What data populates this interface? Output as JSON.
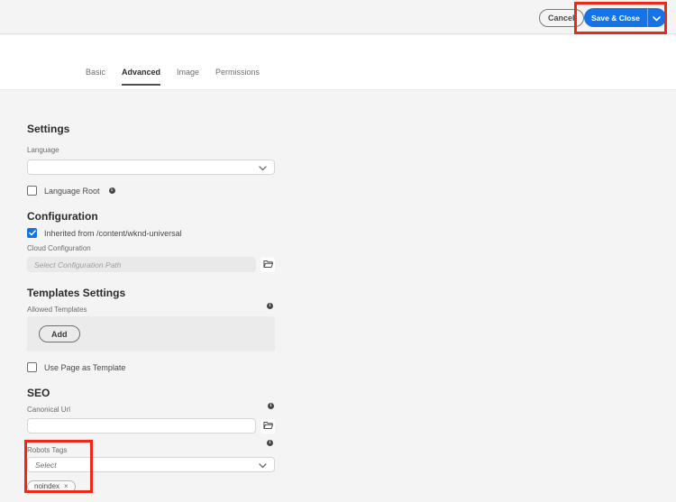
{
  "colors": {
    "accent_blue": "#1473e6",
    "annotation_red": "#ec2817",
    "page_background": "#f4f4f5"
  },
  "header": {
    "cancel_label": "Cancel",
    "save_close_label": "Save & Close"
  },
  "tabs": [
    {
      "label": "Basic",
      "active": false
    },
    {
      "label": "Advanced",
      "active": true
    },
    {
      "label": "Image",
      "active": false
    },
    {
      "label": "Permissions",
      "active": false
    }
  ],
  "settings": {
    "title": "Settings",
    "language": {
      "label": "Language",
      "value": ""
    },
    "language_root": {
      "label": "Language Root",
      "checked": false
    }
  },
  "configuration": {
    "title": "Configuration",
    "inherited": {
      "label": "Inherited from /content/wknd-universal",
      "checked": true
    },
    "cloud_configuration": {
      "label": "Cloud Configuration",
      "placeholder": "Select Configuration Path",
      "value": "",
      "disabled": true
    }
  },
  "templates_settings": {
    "title": "Templates Settings",
    "allowed_templates": {
      "label": "Allowed Templates",
      "add_button_label": "Add"
    },
    "use_page_as_template": {
      "label": "Use Page as Template",
      "checked": false
    }
  },
  "seo": {
    "title": "SEO",
    "canonical_url": {
      "label": "Canonical Url",
      "value": ""
    },
    "robots_tags": {
      "label": "Robots Tags",
      "placeholder": "Select",
      "tags": [
        "noindex"
      ]
    }
  }
}
